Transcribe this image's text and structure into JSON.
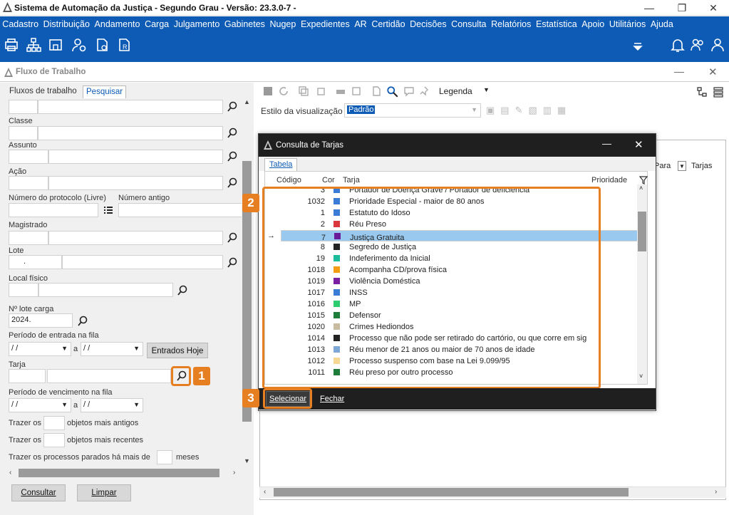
{
  "window": {
    "title": "Sistema de Automação da Justiça - Segundo Grau - Versão: 23.3.0-7 -"
  },
  "menu": [
    "Cadastro",
    "Distribuição",
    "Andamento",
    "Carga",
    "Julgamento",
    "Gabinetes",
    "Nugep",
    "Expedientes",
    "AR",
    "Certidão",
    "Decisões",
    "Consulta",
    "Relatórios",
    "Estatística",
    "Apoio",
    "Utilitários",
    "Ajuda"
  ],
  "toolbar_icons": [
    "printer-icon",
    "sitemap-icon",
    "building-icon",
    "user-gear-icon",
    "document-clock-icon",
    "document-lock-icon",
    "document-r-icon"
  ],
  "flow": {
    "title": "Fluxo de Trabalho"
  },
  "left": {
    "tabs": [
      "Fluxos de trabalho",
      "Pesquisar"
    ],
    "labels": {
      "classe": "Classe",
      "assunto": "Assunto",
      "acao": "Ação",
      "protocolo": "Número do protocolo (Livre)",
      "antigo": "Número antigo",
      "magistrado": "Magistrado",
      "lote": "Lote",
      "local": "Local físico",
      "lote_carga": "Nº lote carga",
      "periodo_entrada": "Período de entrada na fila",
      "a": "a",
      "tarja": "Tarja",
      "periodo_venc": "Período de vencimento na fila",
      "trazer1": "Trazer os",
      "antigos": "objetos mais antigos",
      "trazer2": "Trazer os",
      "recentes": "objetos mais recentes",
      "parados": "Trazer os processos parados há mais de",
      "meses": "meses"
    },
    "values": {
      "lote_dot": ".",
      "lote_carga": "2024.",
      "date": " /  /"
    },
    "entrados_hoje": "Entrados Hoje",
    "consultar": "Consultar",
    "limpar": "Limpar"
  },
  "right": {
    "estilo_label": "Estilo da visualização",
    "estilo_value": "Padrão",
    "legenda": "Legenda",
    "col_para": "Para",
    "col_tarjas": "Tarjas"
  },
  "dialog": {
    "title": "Consulta de Tarjas",
    "tab": "Tabela",
    "columns": {
      "codigo": "Código",
      "cor": "Cor",
      "tarja": "Tarja",
      "prioridade": "Prioridade"
    },
    "rows": [
      {
        "code": "3",
        "color": "#3a7bd5",
        "name": "Portador de Doença Grave / Portador de deficiência"
      },
      {
        "code": "1032",
        "color": "#3a7bd5",
        "name": "Prioridade Especial - maior de 80 anos"
      },
      {
        "code": "1",
        "color": "#3a7bd5",
        "name": "Estatuto do Idoso"
      },
      {
        "code": "2",
        "color": "#d9363e",
        "name": "Réu Preso"
      },
      {
        "code": "7",
        "color": "#6a1b9a",
        "name": "Justiça Gratuita"
      },
      {
        "code": "8",
        "color": "#222222",
        "name": "Segredo de Justiça"
      },
      {
        "code": "19",
        "color": "#1abc9c",
        "name": "Indeferimento da Inicial"
      },
      {
        "code": "1018",
        "color": "#f39c12",
        "name": "Acompanha CD/prova física"
      },
      {
        "code": "1019",
        "color": "#7b1fa2",
        "name": "Violência Doméstica"
      },
      {
        "code": "1017",
        "color": "#3a7bd5",
        "name": "INSS"
      },
      {
        "code": "1016",
        "color": "#2ecc71",
        "name": "MP"
      },
      {
        "code": "1015",
        "color": "#1e7d3a",
        "name": "Defensor"
      },
      {
        "code": "1020",
        "color": "#c8bca0",
        "name": "Crimes Hediondos"
      },
      {
        "code": "1014",
        "color": "#222222",
        "name": "Processo que não pode ser retirado do cartório, ou que corre em sig"
      },
      {
        "code": "1013",
        "color": "#7fa7d6",
        "name": "Réu menor de 21 anos ou maior de 70 anos de idade"
      },
      {
        "code": "1012",
        "color": "#f7d794",
        "name": "Processo suspenso com base na Lei 9.099/95"
      },
      {
        "code": "1011",
        "color": "#1e7d3a",
        "name": "Réu preso por outro processo"
      }
    ],
    "selected_index": 4,
    "selecionar": "Selecionar",
    "fechar": "Fechar"
  },
  "badges": [
    "1",
    "2",
    "3"
  ],
  "accent": "#e67e22",
  "brand": "#0d5bb5"
}
